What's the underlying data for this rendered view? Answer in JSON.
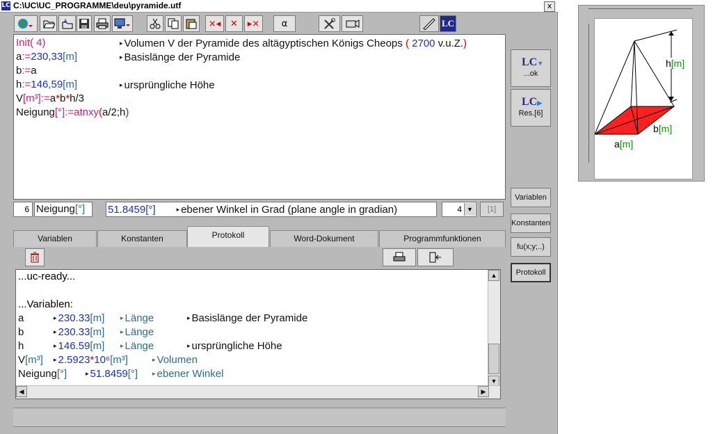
{
  "window": {
    "title": "C:\\UC\\UC_PROGRAMME\\deu\\pyramide.utf",
    "close_label": "x",
    "app_icon": "LC"
  },
  "toolbar": {
    "alpha_label": "α",
    "lc_label": "LC",
    "mark_left": "×◂",
    "mark_mid": "✕",
    "mark_right": "▸×"
  },
  "editor": {
    "l1_code": "Init( 4)",
    "l1_comment_prefix": "Volumen V der Pyramide des altägyptischen Königs Cheops ",
    "l1_paren_open": "(",
    "l1_year": " 2700",
    "l1_era": " v.u.Z.",
    "l1_paren_close": ")",
    "l2_name": "a",
    "l2_assign": ":=",
    "l2_value": "230,33",
    "l2_unit": "[m]",
    "l2_comment": "Basislänge der Pyramide",
    "l3_name": "b",
    "l3_assign": ":=",
    "l3_value": "a",
    "l4_name": "h",
    "l4_assign": ":=",
    "l4_value": "146,59",
    "l4_unit": "[m]",
    "l4_comment": "ursprüngliche Höhe",
    "l5_name": "V",
    "l5_unit": "[m³]",
    "l5_assign": ":=",
    "l5_a": "a",
    "l5_op1": "*",
    "l5_b": "b",
    "l5_op2": "*",
    "l5_h": "h/3",
    "l6_name": "Neigung",
    "l6_unit": "[°]",
    "l6_assign": ":=",
    "l6_func": "atnxy",
    "l6_paren_open": "(",
    "l6_args": "a/2;h",
    "l6_paren_close": ")"
  },
  "status": {
    "line_no": "6",
    "var_name": "Neigung",
    "var_unit": "[°]",
    "value": "51.8459[°]",
    "comment": "ebener Winkel in Grad (plane angle in gradian)",
    "precision": "4",
    "bracket": "[1]"
  },
  "tabs": [
    "Variablen",
    "Konstanten",
    "Protokoll",
    "Word-Dokument",
    "Programmfunktionen"
  ],
  "protocol": {
    "ready": "...uc-ready...",
    "header": "...Variablen:",
    "rows": [
      {
        "name": "a",
        "unit": "",
        "value": "230.33",
        "vunit": "[m]",
        "kind": "Länge",
        "comment": "Basislänge der Pyramide"
      },
      {
        "name": "b",
        "unit": "",
        "value": "230.33",
        "vunit": "[m]",
        "kind": "Länge",
        "comment": ""
      },
      {
        "name": "h",
        "unit": "",
        "value": "146.59",
        "vunit": "[m]",
        "kind": "Länge",
        "comment": "ursprüngliche Höhe"
      },
      {
        "name": "V",
        "unit": "[m³]",
        "value": "2.5923",
        "mult": "*",
        "pow": "10⁶",
        "vunit": "[m³]",
        "kind": "Volumen",
        "comment": ""
      },
      {
        "name": "Neigung",
        "unit": "[°]",
        "value": "51.8459",
        "vunit": "[°]",
        "kind": "ebener Winkel",
        "comment": ""
      }
    ]
  },
  "side_buttons": {
    "ok_label": "...ok",
    "res_label": "Res.[6]",
    "lc_label": "LC",
    "variablen": "Variablen",
    "konstanten": "Konstanten",
    "functions": "fu(x;y;..)",
    "protokoll": "Protokoll"
  },
  "preview": {
    "h_label": "h",
    "h_unit": "[m]",
    "a_label": "a",
    "a_unit": "[m]",
    "b_label": "b",
    "b_unit": "[m]"
  },
  "colors": {
    "accent": "#1f2a8a",
    "pyramid_base": "#ff2020",
    "unit_green": "#1a8a1a",
    "code_pink": "#c0208a",
    "code_red": "#d00000"
  }
}
